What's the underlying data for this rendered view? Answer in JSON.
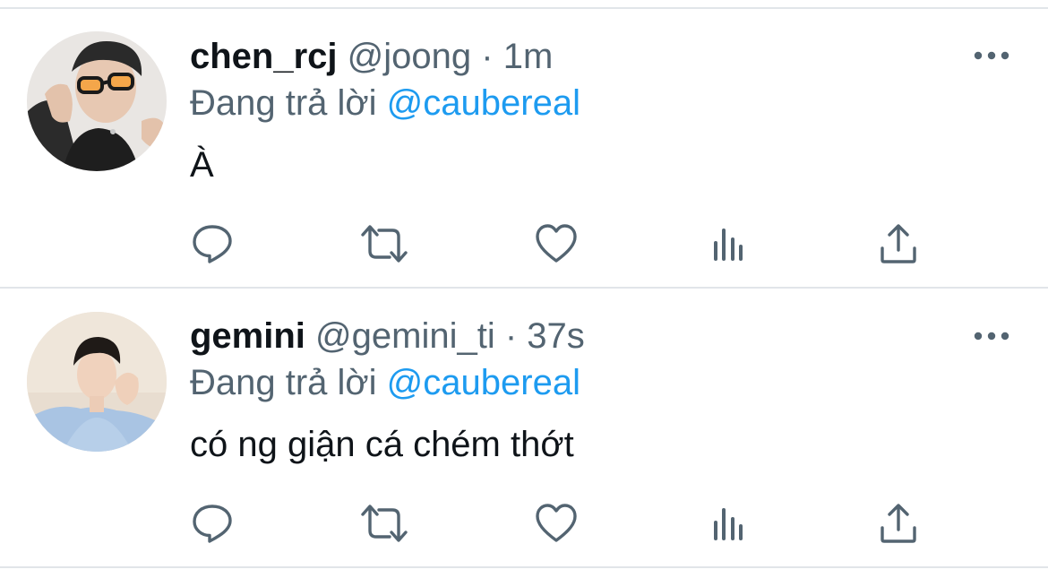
{
  "tweets": [
    {
      "display_name": "chen_rcj",
      "handle": "@joong",
      "separator": "·",
      "time": "1m",
      "reply_prefix": "Đang trả lời",
      "reply_to": "@caubereal",
      "text": "À",
      "avatar_icon": "avatar-photo-sunglasses",
      "more_icon": "more-dots-icon"
    },
    {
      "display_name": "gemini",
      "handle": "@gemini_ti",
      "separator": "·",
      "time": "37s",
      "reply_prefix": "Đang trả lời",
      "reply_to": "@caubereal",
      "text": "có ng giận cá chém thớt",
      "avatar_icon": "avatar-photo-portrait",
      "more_icon": "more-dots-icon"
    }
  ],
  "action_icons": [
    "reply-icon",
    "retweet-icon",
    "like-icon",
    "analytics-icon",
    "share-icon"
  ],
  "colors": {
    "text_primary": "#0f1419",
    "text_secondary": "#536471",
    "link": "#1d9bf0",
    "icon": "#536471",
    "divider": "#e1e5e9",
    "background": "#ffffff"
  }
}
